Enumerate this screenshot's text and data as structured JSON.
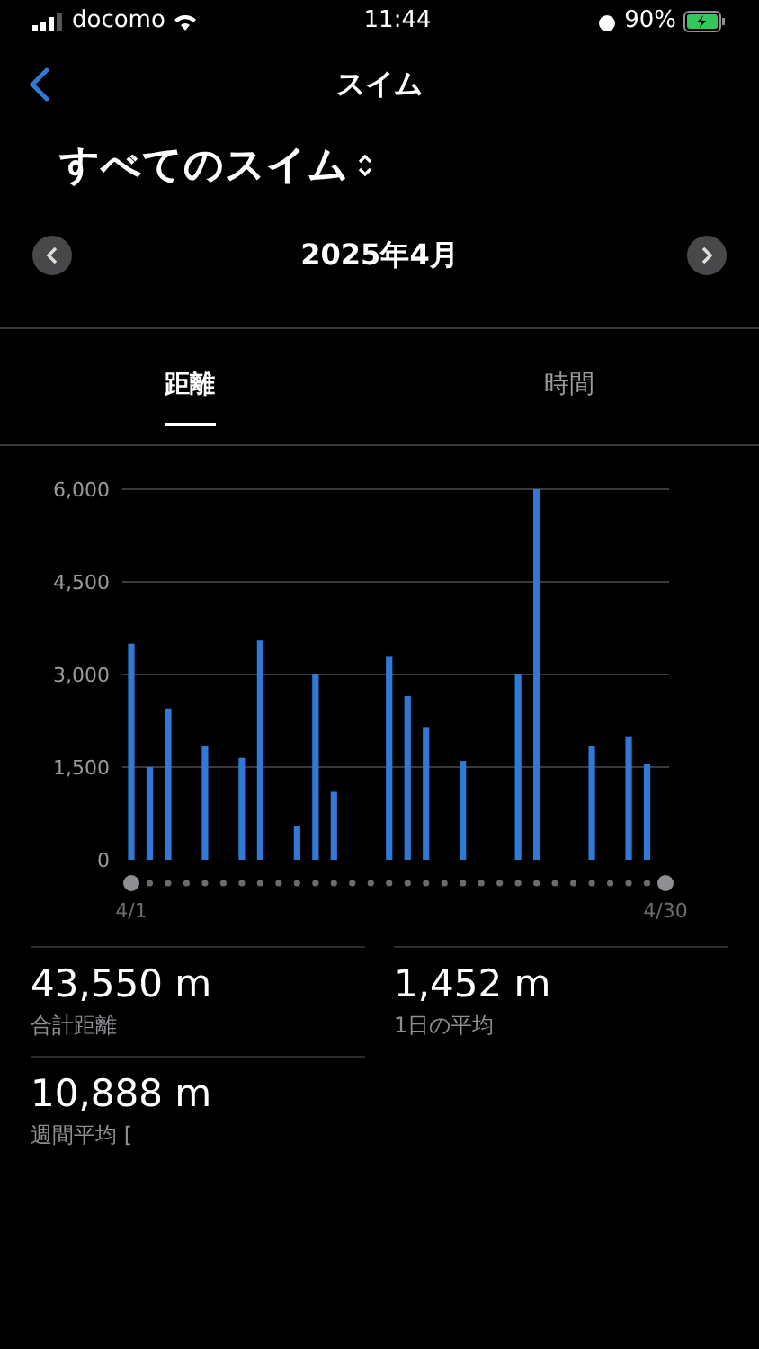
{
  "status_bar": {
    "carrier": "docomo",
    "time": "11:44",
    "battery": "90%"
  },
  "nav": {
    "title": "スイム"
  },
  "filter": {
    "label": "すべてのスイム"
  },
  "period": {
    "label": "2025年4月"
  },
  "tabs": [
    {
      "label": "距離",
      "selected": true
    },
    {
      "label": "時間",
      "selected": false
    }
  ],
  "chart_data": {
    "type": "bar",
    "grid": true,
    "categories": [
      "4/1",
      null,
      null,
      null,
      null,
      null,
      null,
      null,
      null,
      null,
      null,
      null,
      null,
      null,
      null,
      null,
      null,
      null,
      null,
      null,
      null,
      null,
      null,
      null,
      null,
      null,
      null,
      null,
      null,
      "4/30"
    ],
    "values": [
      3500,
      1500,
      2450,
      0,
      1850,
      0,
      1650,
      3550,
      0,
      550,
      3000,
      1100,
      0,
      0,
      3300,
      2650,
      2150,
      0,
      1600,
      0,
      0,
      3000,
      6000,
      0,
      0,
      1850,
      0,
      2000,
      1550,
      0
    ],
    "ylim": [
      0,
      6000
    ],
    "yticks": [
      {
        "value": 0,
        "label": "0"
      },
      {
        "value": 1500,
        "label": "1,500"
      },
      {
        "value": 3000,
        "label": "3,000"
      },
      {
        "value": 4500,
        "label": "4,500"
      },
      {
        "value": 6000,
        "label": "6,000"
      }
    ]
  },
  "stats": [
    {
      "value": "43,550 m",
      "label": "合計距離"
    },
    {
      "value": "1,452 m",
      "label": "1日の平均"
    },
    {
      "value": "10,888 m",
      "label": "週間平均 ["
    }
  ]
}
